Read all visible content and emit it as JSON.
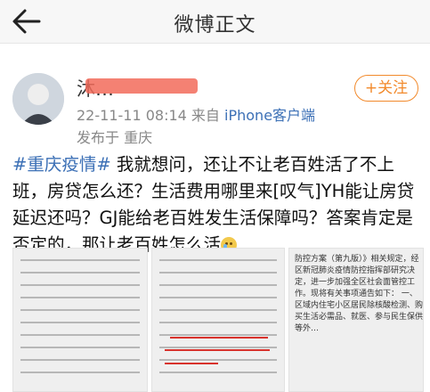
{
  "header": {
    "title": "微博正文",
    "back_icon": "back-arrow-icon"
  },
  "post": {
    "username": "沐…",
    "meta_time": "22-11-11 08:14",
    "meta_from": "来自",
    "meta_source": "iPhone客户端",
    "published_at": "发布于 重庆",
    "follow_label": "+关注",
    "hashtag": "#重庆疫情#",
    "text": " 我就想问，还让不让老百姓活了不上班，房贷怎么还？生活费用哪里来[叹气]YH能让房贷延迟还吗？GJ能给老百姓发生活保障吗？答案肯定是否定的，那让老百姓怎么活"
  },
  "images": {
    "thumb3_text": "防控方案（第九版）》相关规定，经区新冠肺炎疫情防控指挥部研究决定，进一步加强全区社会面管控工作。现将有关事项通告如下：\n一、区域内住宅小区居民除核酸检测、购买生活必需品、就医、参与民生保供等外…"
  },
  "colors": {
    "link": "#3c70b6",
    "follow": "#f28a2c",
    "mask": "#f26b5b"
  }
}
